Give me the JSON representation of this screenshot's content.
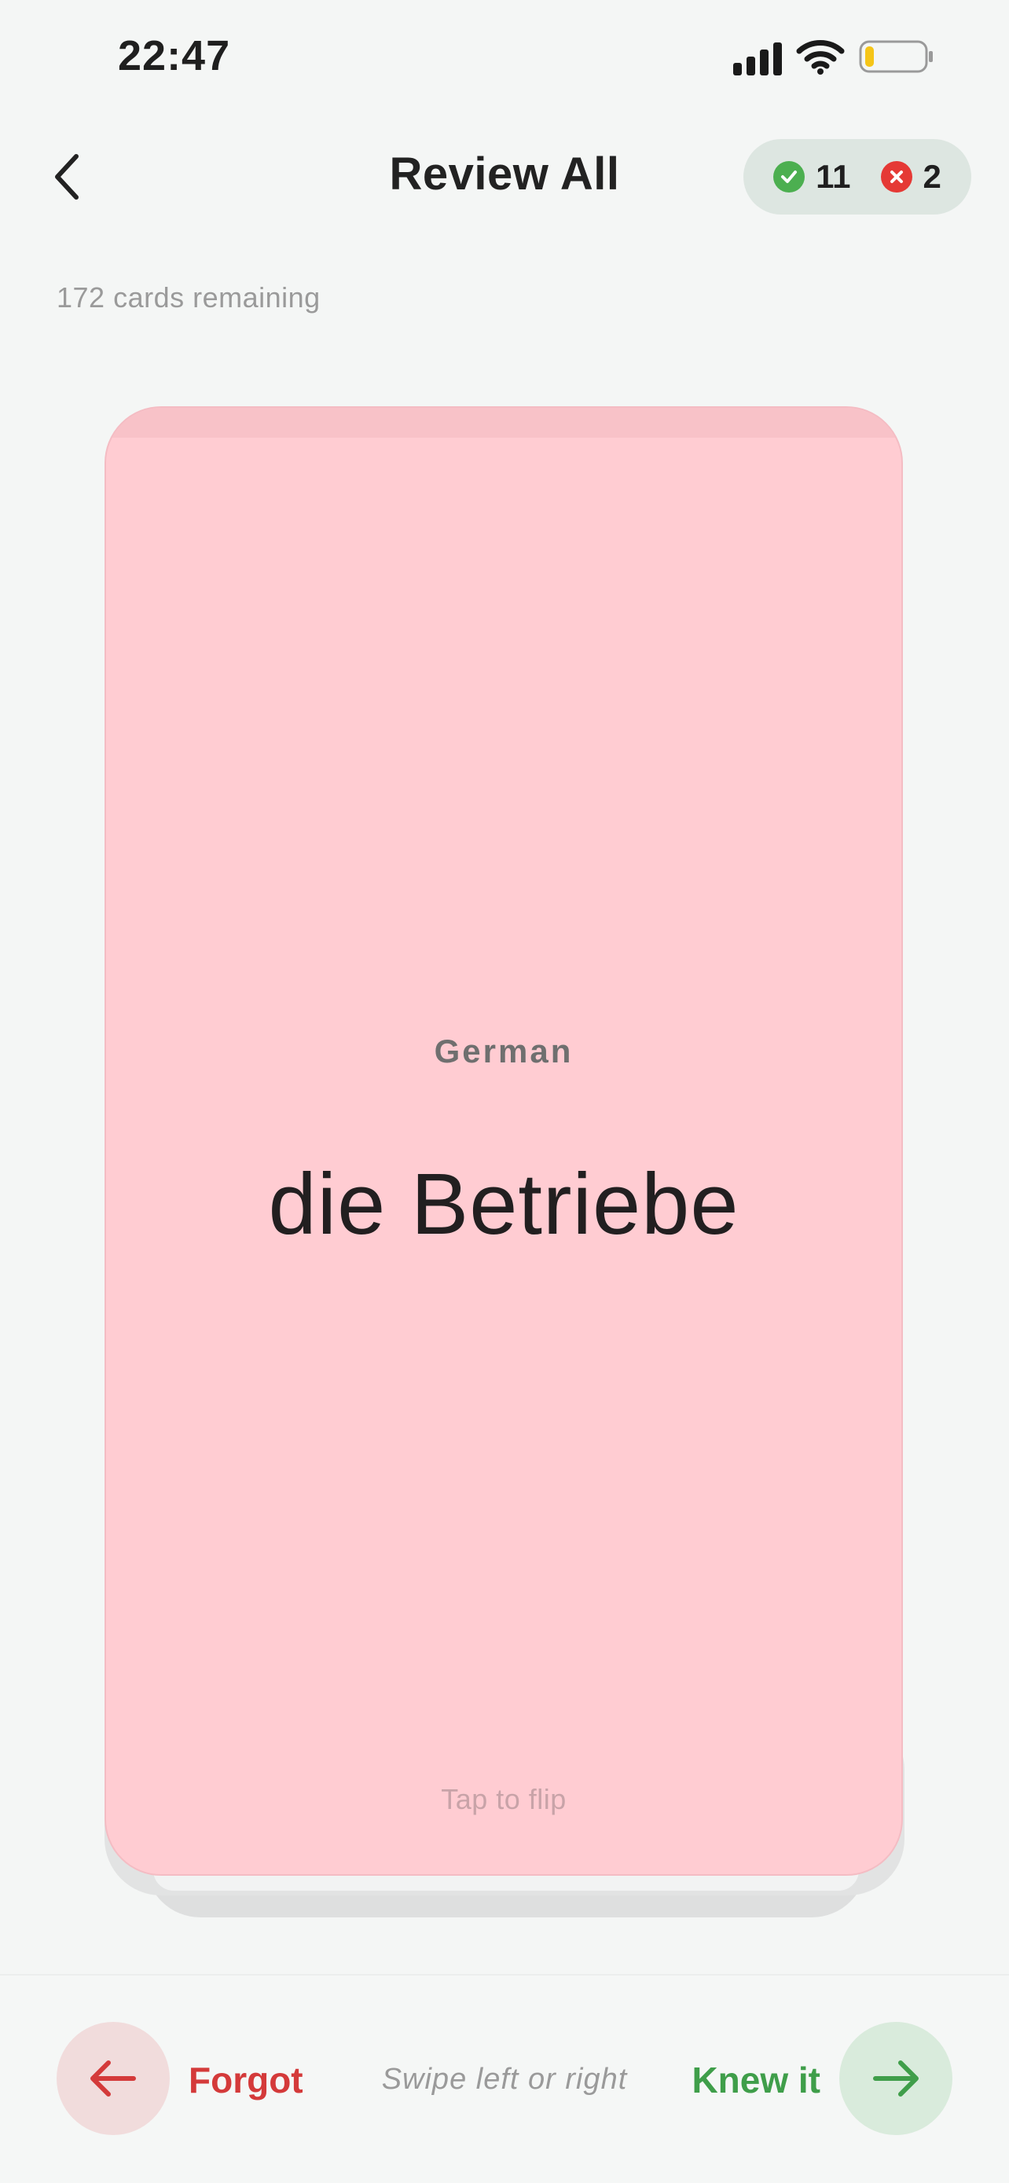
{
  "status_bar": {
    "time": "22:47"
  },
  "header": {
    "title": "Review All",
    "correct_count": "11",
    "wrong_count": "2"
  },
  "progress": {
    "remaining_text": "172 cards remaining"
  },
  "card": {
    "language": "German",
    "word": "die Betriebe",
    "hint": "Tap to flip"
  },
  "actions": {
    "forgot_label": "Forgot",
    "swipe_hint": "Swipe left or right",
    "knew_label": "Knew it"
  },
  "colors": {
    "card_background": "#ffccd2",
    "correct": "#4caf50",
    "wrong": "#e53935",
    "battery_level": "#f5c518"
  },
  "battery": {
    "level": 0.15
  }
}
